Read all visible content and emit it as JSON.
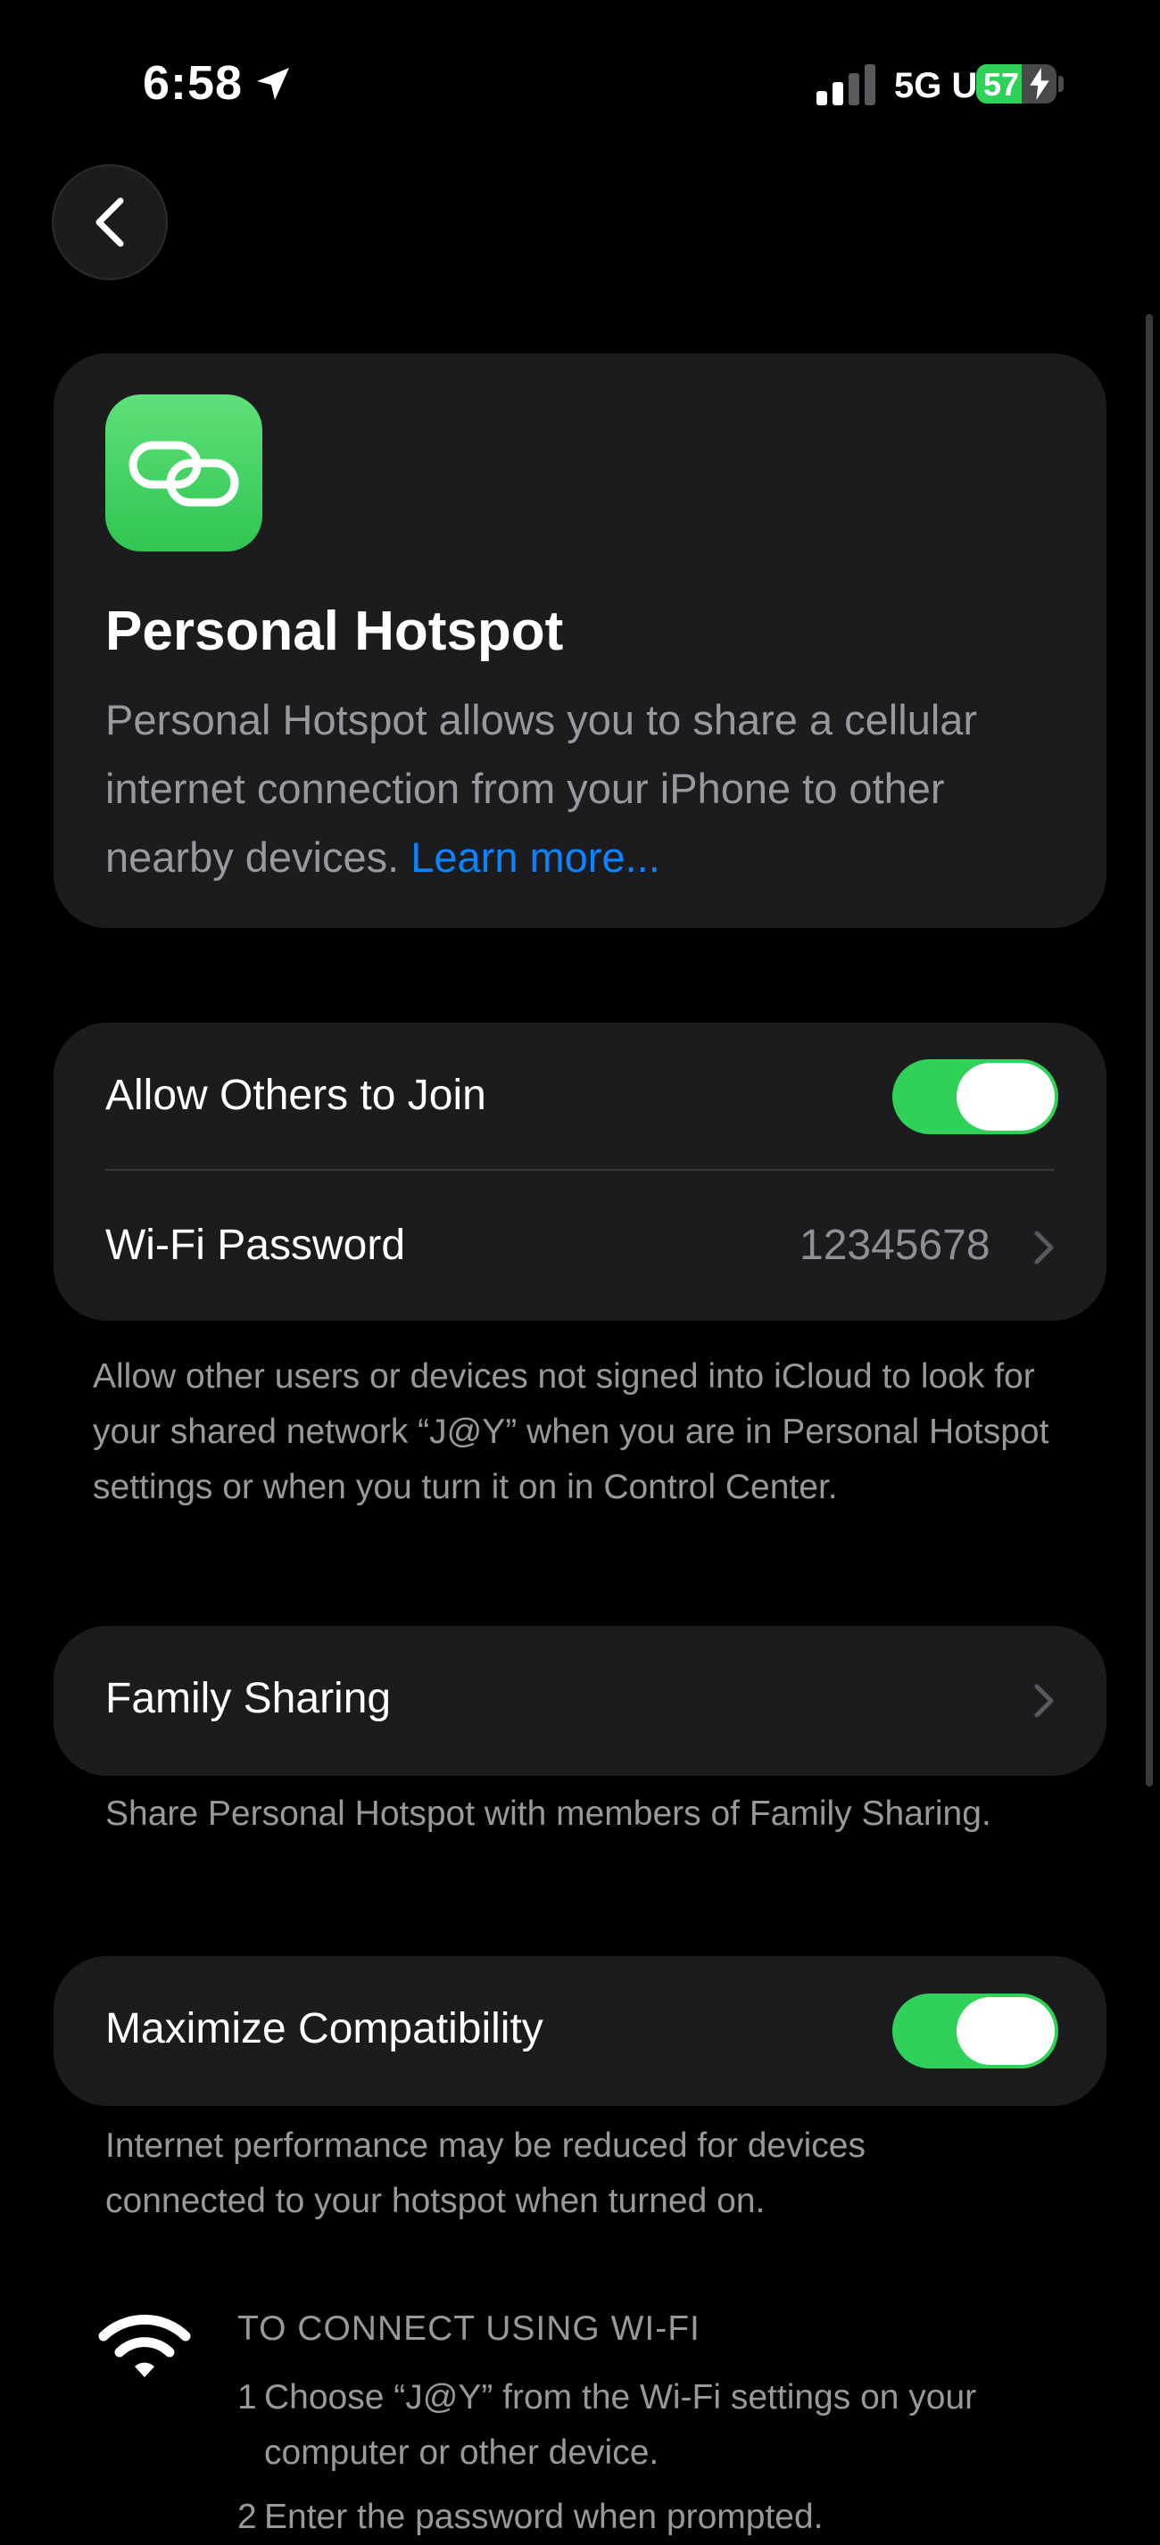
{
  "status_bar": {
    "time": "6:58",
    "network": "5G UC",
    "battery": "57",
    "battery_level": 0.57
  },
  "nav": {
    "back_icon": "chevron-left-icon"
  },
  "hero": {
    "icon": "link-icon",
    "title": "Personal Hotspot",
    "description": "Personal Hotspot allows you to share a cellular internet connection from your iPhone to other nearby devices.",
    "learn_more": "Learn more..."
  },
  "settings": {
    "allow_others": {
      "label": "Allow Others to Join",
      "enabled": true
    },
    "wifi_password": {
      "label": "Wi-Fi Password",
      "value": "12345678"
    },
    "allow_note": "Allow other users or devices not signed into iCloud to look for your shared network “J@Y” when you are in Personal Hotspot settings or when you turn it on in Control Center.",
    "family_sharing": {
      "label": "Family Sharing"
    },
    "family_note": "Share Personal Hotspot with members of Family Sharing.",
    "maximize": {
      "label": "Maximize Compatibility",
      "enabled": true
    },
    "maximize_note": "Internet performance may be reduced for devices connected to your hotspot when turned on."
  },
  "connect": {
    "icon": "wifi-icon",
    "heading": "TO CONNECT USING WI-FI",
    "step1_num": "1",
    "step1_line1": "Choose “J@Y” from the Wi-Fi settings on your",
    "step1_line2": "computer or other device.",
    "step2_num": "2",
    "step2_text": "Enter the password when prompted."
  },
  "colors": {
    "accent": "#0a84ff",
    "toggle_on": "#30d158",
    "card": "#1c1c1e",
    "icon_green": "#34c759"
  }
}
